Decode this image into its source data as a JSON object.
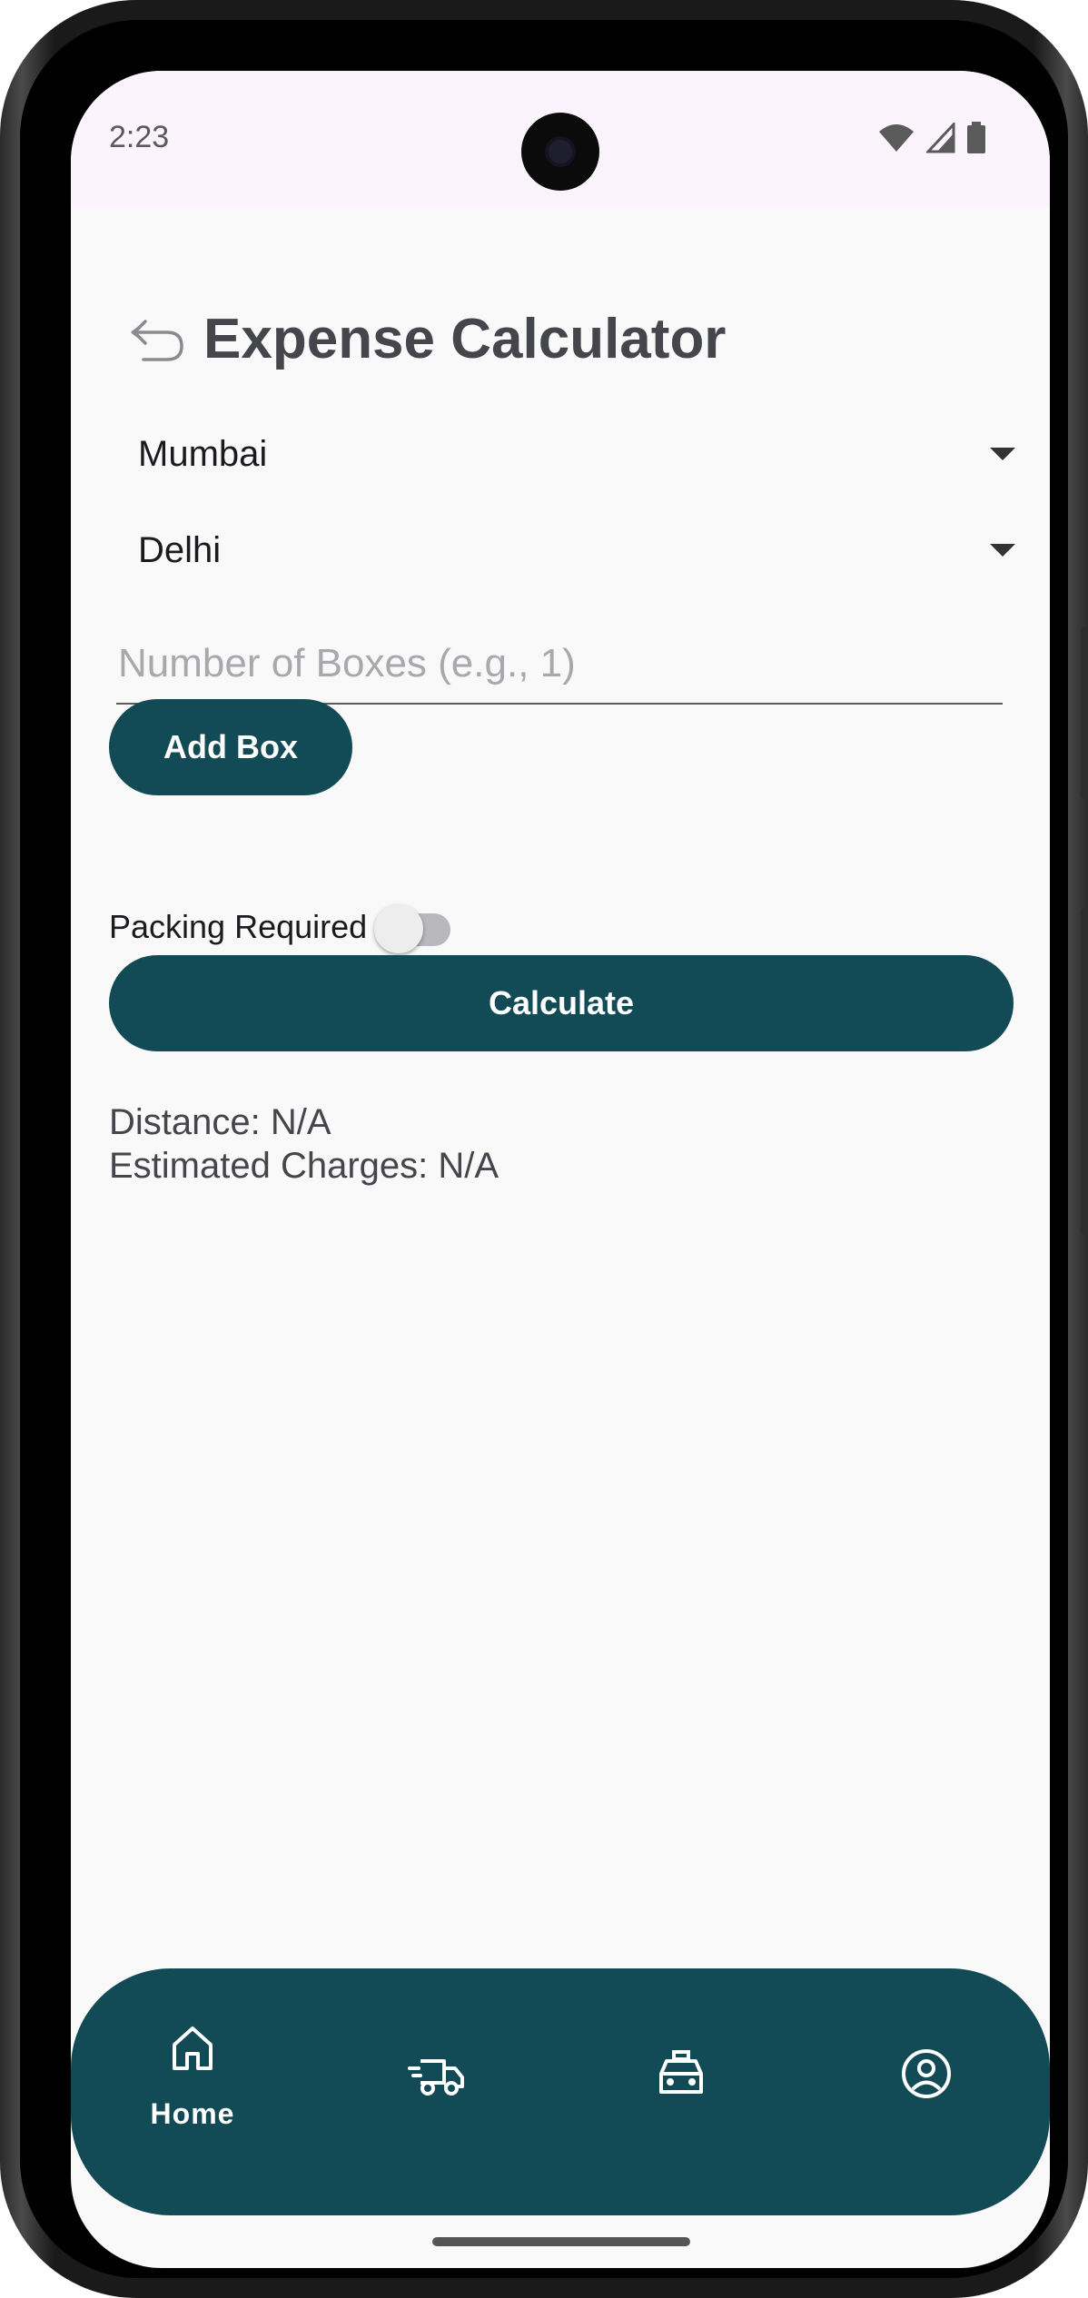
{
  "status_bar": {
    "time": "2:23"
  },
  "header": {
    "title": "Expense Calculator",
    "back_icon": "back-arrow-icon"
  },
  "form": {
    "from_city": "Mumbai",
    "to_city": "Delhi",
    "boxes_placeholder": "Number of Boxes (e.g., 1)",
    "add_box_label": "Add Box",
    "packing_label": "Packing Required",
    "packing_enabled": false,
    "calculate_label": "Calculate"
  },
  "results": {
    "distance": "Distance: N/A",
    "charges": "Estimated Charges: N/A"
  },
  "bottom_nav": {
    "items": [
      {
        "label": "Home",
        "icon": "home-icon",
        "active": true
      },
      {
        "label": "",
        "icon": "moving-truck-icon",
        "active": false
      },
      {
        "label": "",
        "icon": "taxi-icon",
        "active": false
      },
      {
        "label": "",
        "icon": "account-icon",
        "active": false
      }
    ]
  },
  "colors": {
    "primary": "#124a55",
    "background": "#f9f9fa",
    "title": "#45454c"
  }
}
